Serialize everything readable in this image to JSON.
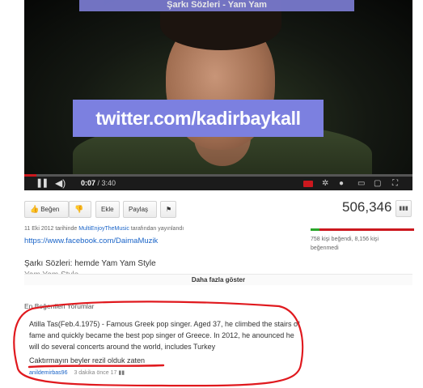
{
  "player": {
    "top_banner_text": "Şarkı Sözleri - Yam Yam",
    "overlay_text": "twitter.com/kadirbaykall",
    "current_time": "0:07",
    "duration": "3:40",
    "progress_fraction": 0.032,
    "accent_color": "#cc181e"
  },
  "actions": {
    "like_label": "Beğen",
    "add_label": "Ekle",
    "share_label": "Paylaş",
    "view_count": "506,346"
  },
  "description": {
    "upload_date": "11 Eki 2012 tarihinde",
    "uploader": "MultiEnjoyTheMusic",
    "upload_suffix": "tarafından yayınlandı",
    "facebook_link": "https://www.facebook.com/DaimaMuzik",
    "likes_text": "758 kişi beğendi, 8,156 kişi beğenmedi",
    "like_fraction": 0.085,
    "lyrics_title": "Şarkı Sözleri: hemde Yam Yam Style",
    "lyrics_line2": "Yam Yam Style",
    "show_more": "Daha fazla göster"
  },
  "comments": {
    "heading": "En Beğenilen Yorumlar",
    "top_comment": {
      "text": "Atilla Tas(Feb.4.1975) - Famous Greek pop singer. Aged 37, he climbed the stairs of fame and quickly became the best pop singer of Greece. In 2012, he anounced he will do several concerts around the world, includes Turkey",
      "reply": "Caktırmayın beyler rezil olduk zaten",
      "author": "anildemirbas96",
      "time": "3 dakika önce",
      "votes": "17"
    }
  },
  "annotation_color": "#e0191e"
}
